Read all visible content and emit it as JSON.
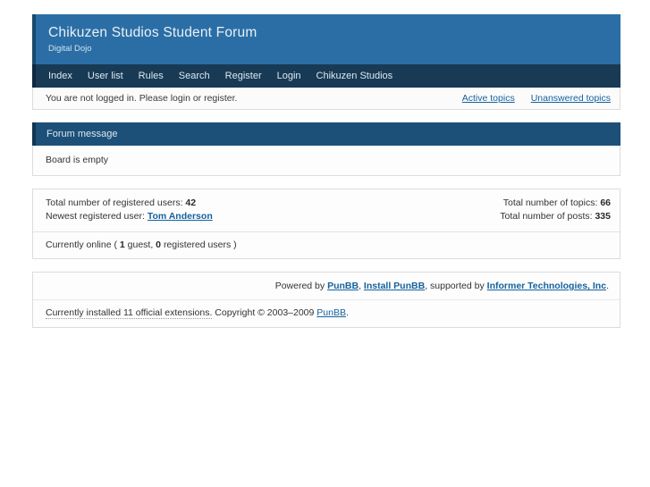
{
  "header": {
    "title": "Chikuzen Studios Student Forum",
    "subtitle": "Digital Dojo",
    "bg_color": "#2b6ea5"
  },
  "nav": {
    "items": [
      {
        "label": "Index"
      },
      {
        "label": "User list"
      },
      {
        "label": "Rules"
      },
      {
        "label": "Search"
      },
      {
        "label": "Register"
      },
      {
        "label": "Login"
      },
      {
        "label": "Chikuzen Studios"
      }
    ],
    "bg_color": "#183a55"
  },
  "status": {
    "message": "You are not logged in. Please login or register.",
    "active_topics": "Active topics",
    "unanswered_topics": "Unanswered topics",
    "link_color": "#15629e"
  },
  "forum_message": {
    "heading": "Forum message",
    "body": "Board is empty"
  },
  "stats": {
    "registered_users_label": "Total number of registered users:",
    "registered_users_value": "42",
    "newest_user_label": "Newest registered user:",
    "newest_user_name": "Tom Anderson",
    "topics_label": "Total number of topics:",
    "topics_value": "66",
    "posts_label": "Total number of posts:",
    "posts_value": "335",
    "online_prefix": "Currently online (",
    "guests_value": "1",
    "guests_label": "guest,",
    "registered_online_value": "0",
    "registered_online_label": "registered users",
    "online_suffix": ")"
  },
  "footer": {
    "powered_prefix": "Powered by",
    "punbb_link": "PunBB",
    "powered_comma": ",",
    "install_link": "Install PunBB",
    "supported_text": ", supported by",
    "informer_link": "Informer Technologies, Inc",
    "period": ".",
    "extensions_note": "Currently installed 11 official extensions.",
    "copyright_text": "Copyright © 2003–2009",
    "copyright_link": "PunBB",
    "copyright_period": "."
  }
}
